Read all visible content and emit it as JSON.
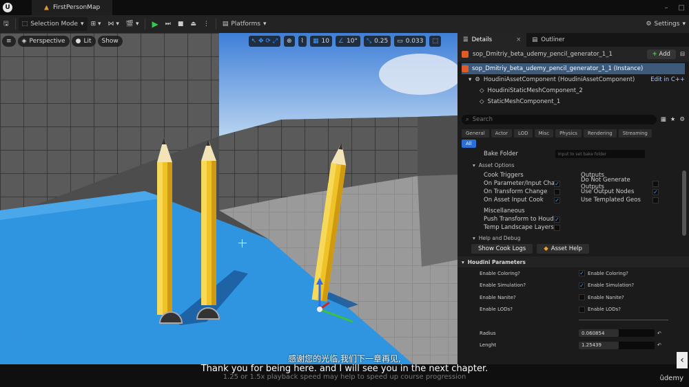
{
  "titlebar": {
    "map_tab": "FirstPersonMap"
  },
  "toolbar": {
    "selection_mode": "Selection Mode",
    "platforms": "Platforms",
    "settings": "Settings"
  },
  "viewport": {
    "perspective": "Perspective",
    "lit": "Lit",
    "show": "Show",
    "grid_snap": "10",
    "rotation_snap": "10°",
    "scale_snap": "0.25",
    "camera_speed": "0.033"
  },
  "panel": {
    "tab_details": "Details",
    "tab_outliner": "Outliner",
    "actor_name": "sop_Dmitriy_beta_udemy_pencil_generator_1_1",
    "add_label": "Add",
    "tree": {
      "instance": "sop_Dmitriy_beta_udemy_pencil_generator_1_1 (Instance)",
      "asset_component": "HoudiniAssetComponent (HoudiniAssetComponent)",
      "edit_cpp": "Edit in C++",
      "static_mesh_2": "HoudiniStaticMeshComponent_2",
      "static_mesh_1": "StaticMeshComponent_1"
    },
    "search_placeholder": "Search",
    "categories": [
      "General",
      "Actor",
      "LOD",
      "Misc",
      "Physics",
      "Rendering",
      "Streaming"
    ],
    "all_label": "All",
    "bake_folder_label": "Bake Folder",
    "bake_folder_placeholder": "Input to set bake folder",
    "asset_options": "Asset Options",
    "cook_triggers": "Cook Triggers",
    "outputs": "Outputs",
    "cook_left": [
      {
        "label": "On Parameter/Input Chan",
        "checked": true
      },
      {
        "label": "On Transform Change",
        "checked": false
      },
      {
        "label": "On Asset Input Cook",
        "checked": true
      }
    ],
    "outputs_list": [
      {
        "label": "Do Not Generate Outputs",
        "checked": false
      },
      {
        "label": "Use Output Nodes",
        "checked": true
      },
      {
        "label": "Use Templated Geos",
        "checked": false
      }
    ],
    "misc_label": "Miscellaneous",
    "misc_list": [
      {
        "label": "Push Transform to Houdi",
        "checked": true
      },
      {
        "label": "Temp Landscape Layers",
        "checked": false
      }
    ],
    "help_debug": "Help and Debug",
    "show_cook_logs": "Show Cook Logs",
    "asset_help": "Asset Help",
    "houdini_params": "Houdini Parameters",
    "params": [
      {
        "label": "Enable Coloring?",
        "value": "Enable Coloring?",
        "checked": true
      },
      {
        "label": "Enable Simulation?",
        "value": "Enable Simulation?",
        "checked": true
      },
      {
        "label": "Enable Nanite?",
        "value": "Enable Nanite?",
        "checked": false
      },
      {
        "label": "Enable LODs?",
        "value": "Enable LODs?",
        "checked": false
      }
    ],
    "radius_label": "Radius",
    "radius_value": "0.060854",
    "length_label": "Lenght",
    "length_value": "1.25439"
  },
  "subtitles": {
    "chinese": "感谢您的光临,我们下一章再见,",
    "english": "Thank you for being here. and I will see you in the next chapter.",
    "faint": "1.25 or 1.5x playback speed may help to speed up course progression",
    "brand": "ûdemy"
  },
  "colors": {
    "accent_blue": "#2a6fd6",
    "play_green": "#35c94b",
    "pencil_yellow": "#f0c22a",
    "floor_blue": "#2f95e0"
  }
}
